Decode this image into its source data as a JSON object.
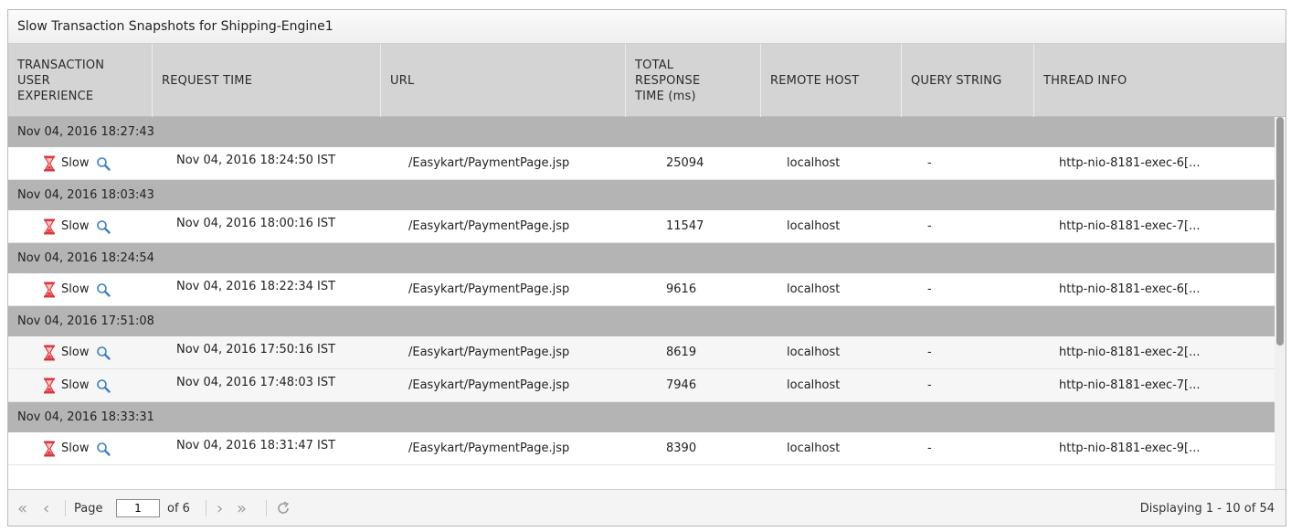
{
  "panel": {
    "title": "Slow Transaction Snapshots for Shipping-Engine1"
  },
  "columns": {
    "tue_l1": "TRANSACTION",
    "tue_l2": "USER",
    "tue_l3": "EXPERIENCE",
    "request_time": "REQUEST TIME",
    "url": "URL",
    "trt_l1": "TOTAL",
    "trt_l2": "RESPONSE",
    "trt_l3": "TIME (ms)",
    "remote_host": "REMOTE HOST",
    "query_string": "QUERY STRING",
    "thread_info": "THREAD INFO"
  },
  "groups": [
    {
      "label": "Nov 04, 2016 18:27:43",
      "rows": [
        {
          "experience": "Slow",
          "request_time": "Nov 04, 2016 18:24:50 IST",
          "url": "/Easykart/PaymentPage.jsp",
          "response_time": "25094",
          "remote_host": "localhost",
          "query_string": "-",
          "thread_info": "http-nio-8181-exec-6[..."
        }
      ]
    },
    {
      "label": "Nov 04, 2016 18:03:43",
      "rows": [
        {
          "experience": "Slow",
          "request_time": "Nov 04, 2016 18:00:16 IST",
          "url": "/Easykart/PaymentPage.jsp",
          "response_time": "11547",
          "remote_host": "localhost",
          "query_string": "-",
          "thread_info": "http-nio-8181-exec-7[..."
        }
      ]
    },
    {
      "label": "Nov 04, 2016 18:24:54",
      "rows": [
        {
          "experience": "Slow",
          "request_time": "Nov 04, 2016 18:22:34 IST",
          "url": "/Easykart/PaymentPage.jsp",
          "response_time": "9616",
          "remote_host": "localhost",
          "query_string": "-",
          "thread_info": "http-nio-8181-exec-6[..."
        }
      ]
    },
    {
      "label": "Nov 04, 2016 17:51:08",
      "rows": [
        {
          "experience": "Slow",
          "request_time": "Nov 04, 2016 17:50:16 IST",
          "url": "/Easykart/PaymentPage.jsp",
          "response_time": "8619",
          "remote_host": "localhost",
          "query_string": "-",
          "thread_info": "http-nio-8181-exec-2[..."
        },
        {
          "experience": "Slow",
          "request_time": "Nov 04, 2016 17:48:03 IST",
          "url": "/Easykart/PaymentPage.jsp",
          "response_time": "7946",
          "remote_host": "localhost",
          "query_string": "-",
          "thread_info": "http-nio-8181-exec-7[..."
        }
      ]
    },
    {
      "label": "Nov 04, 2016 18:33:31",
      "rows": [
        {
          "experience": "Slow",
          "request_time": "Nov 04, 2016 18:31:47 IST",
          "url": "/Easykart/PaymentPage.jsp",
          "response_time": "8390",
          "remote_host": "localhost",
          "query_string": "-",
          "thread_info": "http-nio-8181-exec-9[..."
        }
      ]
    }
  ],
  "pager": {
    "page_label": "Page",
    "page_value": "1",
    "of_label": "of 6",
    "display_text": "Displaying 1 - 10 of 54"
  },
  "icons": {
    "slow": "hourglass-icon",
    "details": "magnifier-icon",
    "first": "double-chevron-left-icon",
    "prev": "chevron-left-icon",
    "next": "chevron-right-icon",
    "last": "double-chevron-right-icon",
    "refresh": "refresh-icon"
  },
  "colors": {
    "header_bg": "#d4d4d4",
    "group_bg": "#b4b4b4",
    "slow_icon": "#d9363e",
    "search_icon": "#3f7fc0"
  }
}
